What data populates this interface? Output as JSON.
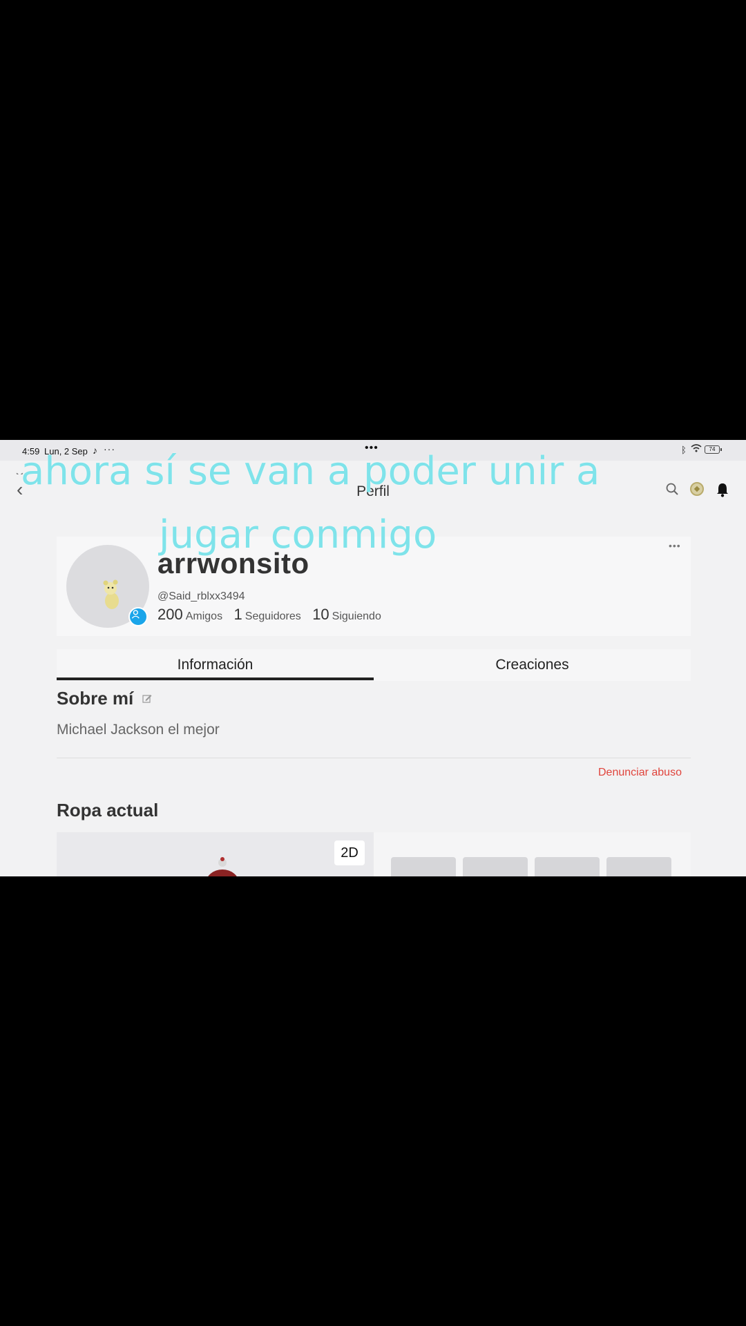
{
  "status_bar": {
    "time": "4:59",
    "date": "Lun, 2 Sep",
    "battery": "74"
  },
  "nav": {
    "title": "Perfil"
  },
  "profile": {
    "display_name": "arrwonsito",
    "handle": "@Said_rblxx3494",
    "friends_count": "200",
    "friends_label": "Amigos",
    "followers_count": "1",
    "followers_label": "Seguidores",
    "following_count": "10",
    "following_label": "Siguiendo"
  },
  "tabs": [
    {
      "label": "Información",
      "active": true
    },
    {
      "label": "Creaciones",
      "active": false
    }
  ],
  "about": {
    "heading": "Sobre mí",
    "bio": "Michael Jackson el mejor",
    "report_label": "Denunciar abuso"
  },
  "outfit": {
    "heading": "Ropa actual",
    "view_toggle": "2D"
  },
  "overlay_caption": {
    "line1": "ahora sí se van a poder unir a",
    "line2": "jugar conmigo"
  },
  "colors": {
    "accent_badge": "#1aa5ea",
    "report": "#e0443c",
    "caption": "#7fe3ea"
  }
}
